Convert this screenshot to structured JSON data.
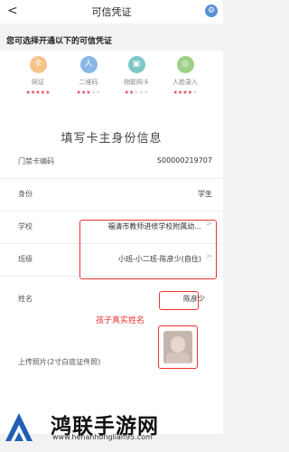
{
  "header": {
    "title": "可信凭证"
  },
  "hint": "您可选择开通以下的可信凭证",
  "options": [
    {
      "label": "网证",
      "icon": "id-card-icon",
      "glyph": "卡",
      "color": "#f4c48a",
      "stars_filled": 5,
      "stars_total": 5
    },
    {
      "label": "二维码",
      "icon": "person-icon",
      "glyph": "人",
      "color": "#8ab7e6",
      "stars_filled": 3,
      "stars_total": 5
    },
    {
      "label": "物联网卡",
      "icon": "iot-card-icon",
      "glyph": "▣",
      "color": "#7ec7c8",
      "stars_filled": 2,
      "stars_total": 5
    },
    {
      "label": "人脸录入",
      "icon": "face-scan-icon",
      "glyph": "◎",
      "color": "#9fd08a",
      "stars_filled": 4,
      "stars_total": 5
    }
  ],
  "form": {
    "title": "填写卡主身份信息",
    "card_number_label": "门禁卡编码",
    "card_number_value": "S00000219707",
    "identity_label": "身份",
    "identity_value": "学生",
    "school_label": "学校",
    "school_value": "福清市教师进修学校附属幼...",
    "class_label": "班级",
    "class_value": "小班-小二班-陈彦少(自住)",
    "name_label": "姓名",
    "name_value": "陈彦少",
    "upload_label": "上传照片(2寸白底证件照)"
  },
  "annotation": "孩子真实姓名",
  "footer": {
    "brand": "鸿联手游网",
    "url": "www.henanhonglian95.com"
  },
  "colors": {
    "accent_red": "#e33333",
    "star_pink": "#e0435e"
  }
}
